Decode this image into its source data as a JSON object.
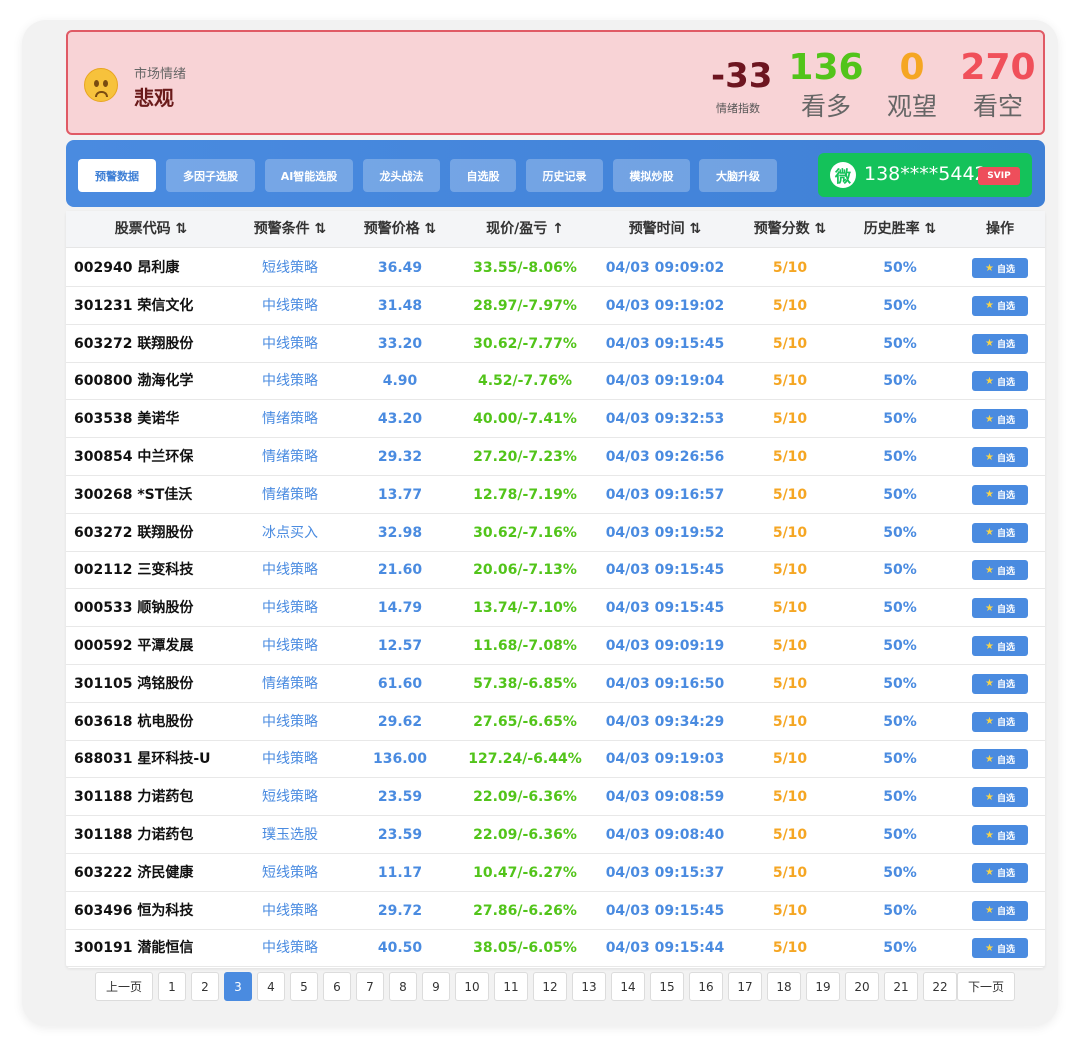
{
  "sentiment": {
    "label": "市场情绪",
    "value": "悲观",
    "index_value": "-33",
    "index_label": "情绪指数",
    "bull": {
      "num": "136",
      "label": "看多",
      "color": "#52c41a"
    },
    "watch": {
      "num": "0",
      "label": "观望",
      "color": "#f5a623"
    },
    "bear": {
      "num": "270",
      "label": "看空",
      "color": "#f0505a"
    }
  },
  "nav": {
    "tabs": [
      {
        "label": "预警数据",
        "active": true
      },
      {
        "label": "多因子选股"
      },
      {
        "label": "AI智能选股"
      },
      {
        "label": "龙头战法"
      },
      {
        "label": "自选股"
      },
      {
        "label": "历史记录"
      },
      {
        "label": "模拟炒股"
      },
      {
        "label": "大脑升级"
      }
    ],
    "user": {
      "icon": "wechat-icon",
      "icon_glyph": "微",
      "phone": "138****5442",
      "badge": "SVIP"
    }
  },
  "table": {
    "headers": [
      "股票代码 ⇅",
      "预警条件 ⇅",
      "预警价格 ⇅",
      "现价/盈亏 ↑",
      "预警时间 ⇅",
      "预警分数 ⇅",
      "历史胜率 ⇅",
      "操作"
    ],
    "action_label": "自选",
    "rows": [
      {
        "stock": "002940 昂利康",
        "cond": "短线策略",
        "price": "36.49",
        "now": "33.55/-8.06%",
        "time": "04/03 09:09:02",
        "score": "5/10",
        "win": "50%"
      },
      {
        "stock": "301231 荣信文化",
        "cond": "中线策略",
        "price": "31.48",
        "now": "28.97/-7.97%",
        "time": "04/03 09:19:02",
        "score": "5/10",
        "win": "50%"
      },
      {
        "stock": "603272 联翔股份",
        "cond": "中线策略",
        "price": "33.20",
        "now": "30.62/-7.77%",
        "time": "04/03 09:15:45",
        "score": "5/10",
        "win": "50%"
      },
      {
        "stock": "600800 渤海化学",
        "cond": "中线策略",
        "price": "4.90",
        "now": "4.52/-7.76%",
        "time": "04/03 09:19:04",
        "score": "5/10",
        "win": "50%"
      },
      {
        "stock": "603538 美诺华",
        "cond": "情绪策略",
        "price": "43.20",
        "now": "40.00/-7.41%",
        "time": "04/03 09:32:53",
        "score": "5/10",
        "win": "50%"
      },
      {
        "stock": "300854 中兰环保",
        "cond": "情绪策略",
        "price": "29.32",
        "now": "27.20/-7.23%",
        "time": "04/03 09:26:56",
        "score": "5/10",
        "win": "50%"
      },
      {
        "stock": "300268 *ST佳沃",
        "cond": "情绪策略",
        "price": "13.77",
        "now": "12.78/-7.19%",
        "time": "04/03 09:16:57",
        "score": "5/10",
        "win": "50%"
      },
      {
        "stock": "603272 联翔股份",
        "cond": "冰点买入",
        "price": "32.98",
        "now": "30.62/-7.16%",
        "time": "04/03 09:19:52",
        "score": "5/10",
        "win": "50%"
      },
      {
        "stock": "002112 三变科技",
        "cond": "中线策略",
        "price": "21.60",
        "now": "20.06/-7.13%",
        "time": "04/03 09:15:45",
        "score": "5/10",
        "win": "50%"
      },
      {
        "stock": "000533 顺钠股份",
        "cond": "中线策略",
        "price": "14.79",
        "now": "13.74/-7.10%",
        "time": "04/03 09:15:45",
        "score": "5/10",
        "win": "50%"
      },
      {
        "stock": "000592 平潭发展",
        "cond": "中线策略",
        "price": "12.57",
        "now": "11.68/-7.08%",
        "time": "04/03 09:09:19",
        "score": "5/10",
        "win": "50%"
      },
      {
        "stock": "301105 鸿铭股份",
        "cond": "情绪策略",
        "price": "61.60",
        "now": "57.38/-6.85%",
        "time": "04/03 09:16:50",
        "score": "5/10",
        "win": "50%"
      },
      {
        "stock": "603618 杭电股份",
        "cond": "中线策略",
        "price": "29.62",
        "now": "27.65/-6.65%",
        "time": "04/03 09:34:29",
        "score": "5/10",
        "win": "50%"
      },
      {
        "stock": "688031 星环科技-U",
        "cond": "中线策略",
        "price": "136.00",
        "now": "127.24/-6.44%",
        "time": "04/03 09:19:03",
        "score": "5/10",
        "win": "50%"
      },
      {
        "stock": "301188 力诺药包",
        "cond": "短线策略",
        "price": "23.59",
        "now": "22.09/-6.36%",
        "time": "04/03 09:08:59",
        "score": "5/10",
        "win": "50%"
      },
      {
        "stock": "301188 力诺药包",
        "cond": "璞玉选股",
        "price": "23.59",
        "now": "22.09/-6.36%",
        "time": "04/03 09:08:40",
        "score": "5/10",
        "win": "50%"
      },
      {
        "stock": "603222 济民健康",
        "cond": "短线策略",
        "price": "11.17",
        "now": "10.47/-6.27%",
        "time": "04/03 09:15:37",
        "score": "5/10",
        "win": "50%"
      },
      {
        "stock": "603496 恒为科技",
        "cond": "中线策略",
        "price": "29.72",
        "now": "27.86/-6.26%",
        "time": "04/03 09:15:45",
        "score": "5/10",
        "win": "50%"
      },
      {
        "stock": "300191 潜能恒信",
        "cond": "中线策略",
        "price": "40.50",
        "now": "38.05/-6.05%",
        "time": "04/03 09:15:44",
        "score": "5/10",
        "win": "50%"
      }
    ]
  },
  "pagination": {
    "prev": "上一页",
    "next": "下一页",
    "current": "3",
    "pages": [
      "1",
      "2",
      "3",
      "4",
      "5",
      "6",
      "7",
      "8",
      "9",
      "10",
      "11",
      "12",
      "13",
      "14",
      "15",
      "16",
      "17",
      "18",
      "19",
      "20",
      "21",
      "22"
    ]
  }
}
